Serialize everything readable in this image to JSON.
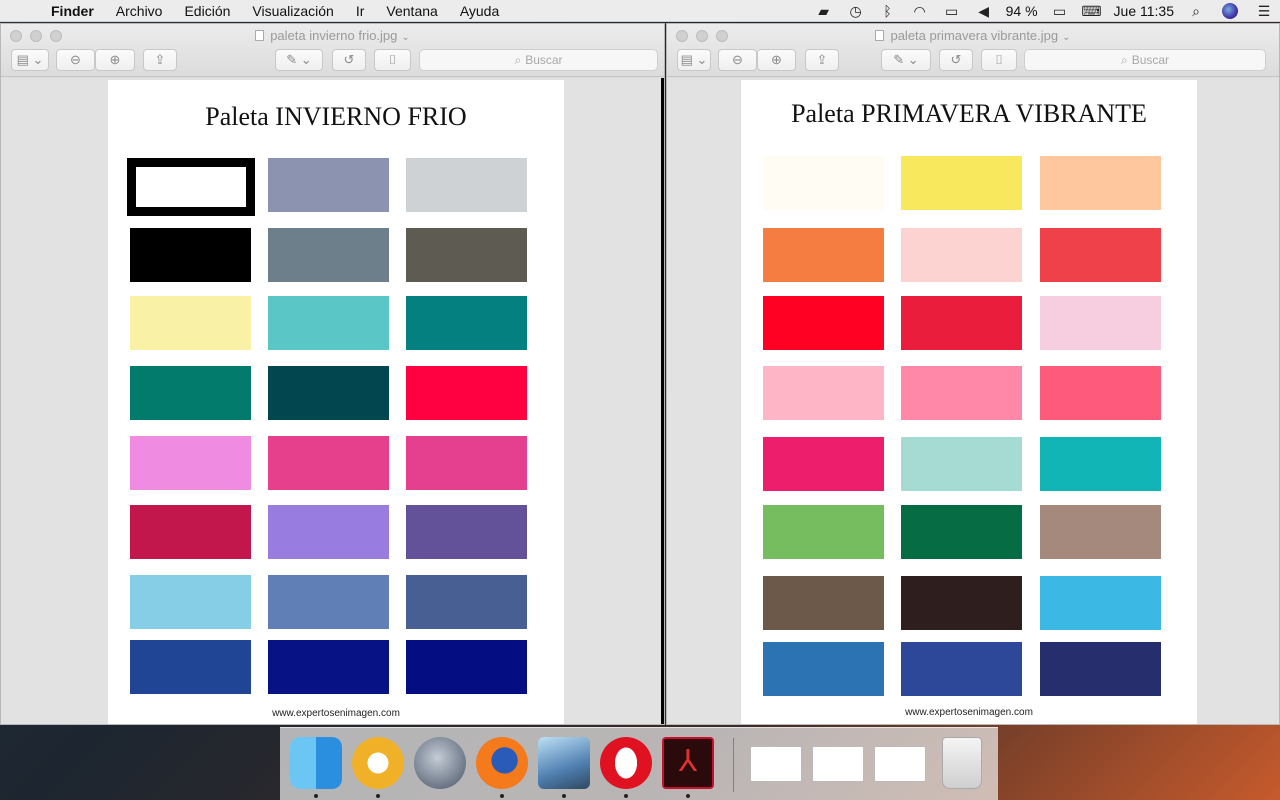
{
  "menubar": {
    "apple": "",
    "items": [
      "Finder",
      "Archivo",
      "Edición",
      "Visualización",
      "Ir",
      "Ventana",
      "Ayuda"
    ],
    "battery": "94 %",
    "clock": "Jue 11:35"
  },
  "windows": [
    {
      "title": "paleta invierno frio.jpg",
      "search_placeholder": "Buscar",
      "page_title": "Paleta INVIERNO FRIO",
      "footer": "www.expertosenimagen.com",
      "swatches": [
        [
          "framed",
          "#8c93b0",
          "#cfd2d5"
        ],
        [
          "#000000",
          "#6e7f8c",
          "#5d5b52"
        ],
        [
          "#f8f1a6",
          "#5ac6c6",
          "#058080"
        ],
        [
          "#027a6c",
          "#02464f",
          "#ff0040"
        ],
        [
          "#ef8ce2",
          "#e63f8c",
          "#e4408f"
        ],
        [
          "#c2174c",
          "#987cdf",
          "#63529a"
        ],
        [
          "#86cde6",
          "#5f7fb6",
          "#485f94"
        ],
        [
          "#1f4594",
          "#071384",
          "#040e82"
        ]
      ]
    },
    {
      "title": "paleta primavera vibrante.jpg",
      "search_placeholder": "Buscar",
      "page_title": "Paleta PRIMAVERA VIBRANTE",
      "footer": "www.expertosenimagen.com",
      "swatches": [
        [
          "#fffcf4",
          "#f8e85e",
          "#fec79e"
        ],
        [
          "#f67d42",
          "#fdd3d1",
          "#ef414a"
        ],
        [
          "#ff0123",
          "#ea1e3c",
          "#f7cee0"
        ],
        [
          "#feb5c5",
          "#ff88a9",
          "#fe5b7c"
        ],
        [
          "#ed1f6c",
          "#a5dbd3",
          "#12b5b6"
        ],
        [
          "#76bd60",
          "#066c43",
          "#a5897c"
        ],
        [
          "#6d5949",
          "#2e1f1e",
          "#3cb8e5"
        ],
        [
          "#2b73b3",
          "#2d4898",
          "#262e6d"
        ]
      ]
    }
  ],
  "dock": {
    "apps": [
      "Finder",
      "Chrome",
      "Launchpad",
      "Firefox",
      "Vista Previa",
      "Opera",
      "Acrobat Reader"
    ],
    "acrobat_glyph": "⅄"
  }
}
